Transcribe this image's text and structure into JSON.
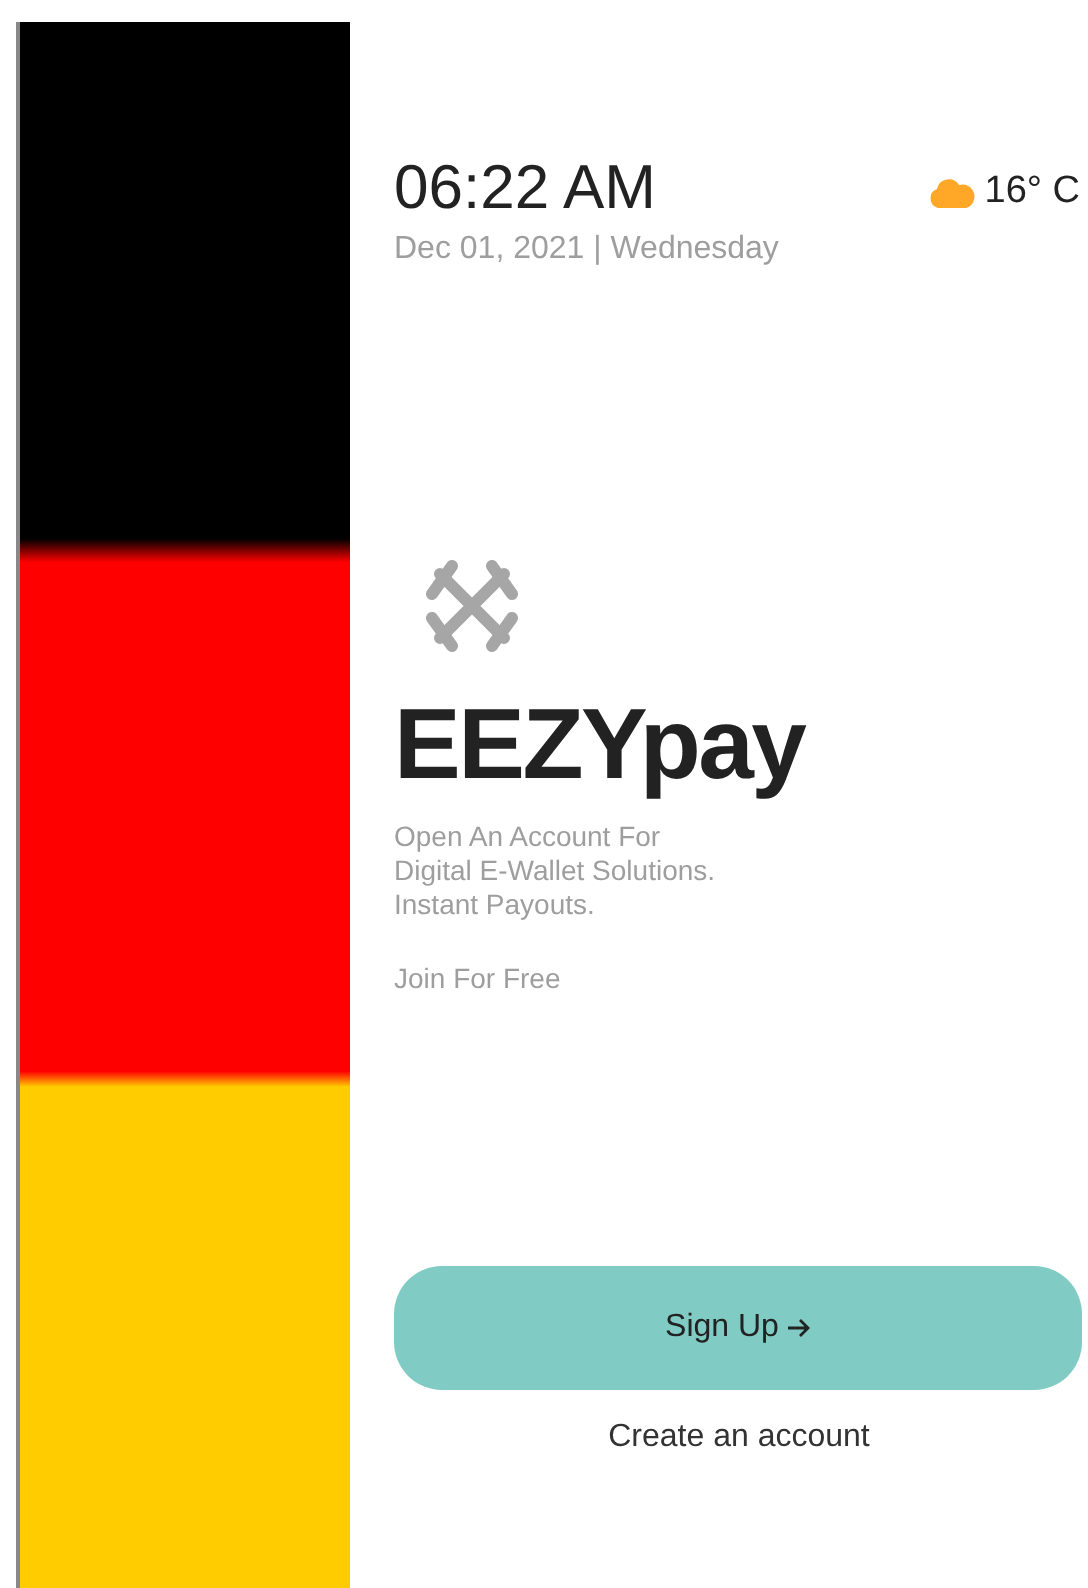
{
  "clock": {
    "time": "06:22 AM",
    "date": "Dec 01, 2021 | Wednesday"
  },
  "weather": {
    "temperature": "16° C"
  },
  "brand": {
    "name": "EEZYpay",
    "tagline_lines": [
      "Open An Account For",
      "Digital E-Wallet Solutions.",
      "Instant Payouts."
    ],
    "join": "Join For Free"
  },
  "signup_button": {
    "label": "Sign Up"
  },
  "create_account_link": "Create an account"
}
